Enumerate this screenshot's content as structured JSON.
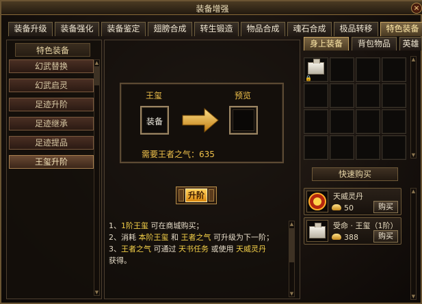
{
  "window": {
    "title": "装备增强",
    "close": "×"
  },
  "tabs": [
    {
      "label": "装备升级",
      "active": false
    },
    {
      "label": "装备强化",
      "active": false
    },
    {
      "label": "装备鉴定",
      "active": false
    },
    {
      "label": "翅膀合成",
      "active": false
    },
    {
      "label": "转生锻造",
      "active": false
    },
    {
      "label": "物品合成",
      "active": false
    },
    {
      "label": "魂石合成",
      "active": false
    },
    {
      "label": "极品转移",
      "active": false
    },
    {
      "label": "特色装备",
      "active": true
    }
  ],
  "left_menu": {
    "header": "特色装备",
    "items": [
      {
        "label": "幻武替换",
        "active": false
      },
      {
        "label": "幻武启灵",
        "active": false
      },
      {
        "label": "足迹升阶",
        "active": false
      },
      {
        "label": "足迹继承",
        "active": false
      },
      {
        "label": "足迹提品",
        "active": false
      },
      {
        "label": "王玺升阶",
        "active": true
      }
    ]
  },
  "upgrade": {
    "equip_label": "王玺",
    "preview_label": "预览",
    "slot_text": "装备",
    "need_text": "需要王者之气：635",
    "button": "升阶"
  },
  "description": {
    "line1": {
      "prefix": "1、",
      "hl1": "1阶王玺",
      "rest": " 可在商城购买；"
    },
    "line2": {
      "prefix": "2、消耗 ",
      "hl1": "本阶王玺",
      "mid": " 和 ",
      "hl2": "王者之气",
      "rest": " 可升级为下一阶；"
    },
    "line3": {
      "prefix": "3、",
      "hl1": "王者之气",
      "mid": " 可通过 ",
      "hl2": "天书任务",
      "mid2": " 或使用 ",
      "hl3": "天威灵丹"
    },
    "line4": "获得。"
  },
  "right_tabs": [
    {
      "label": "身上装备",
      "active": true
    },
    {
      "label": "背包物品",
      "active": false
    },
    {
      "label": "英雄",
      "active": false
    }
  ],
  "quick_buy": {
    "header": "快速购买",
    "items": [
      {
        "name": "天威灵丹",
        "price": "50",
        "button": "购买"
      },
      {
        "name": "受命 · 王玺（1阶）",
        "price": "388",
        "button": "购买"
      }
    ]
  },
  "icons": [
    "close-icon",
    "arrow-right-icon",
    "lock-icon",
    "ingot-icon",
    "seal-icon",
    "dan-icon"
  ],
  "colors": {
    "accent_gold": "#f1c24b",
    "frame": "#6b5533",
    "active_tab": "#7a6543"
  }
}
